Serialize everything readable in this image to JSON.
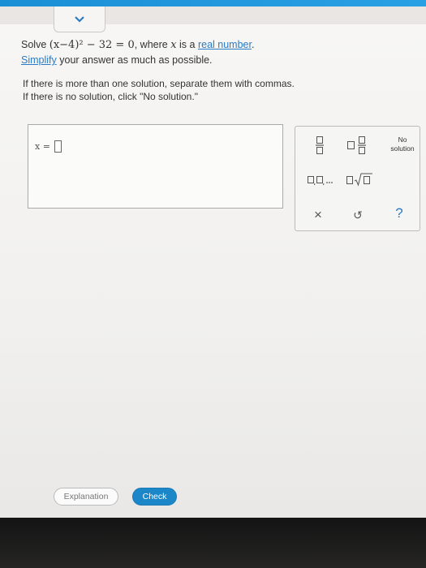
{
  "question": {
    "prefix": "Solve ",
    "equation": "(x−4)² − 32 = 0",
    "mid": ", where ",
    "var": "x",
    "mid2": " is a ",
    "link": "real number",
    "end": ".",
    "simplify_link": "Simplify",
    "simplify_rest": " your answer as much as possible."
  },
  "instructions": {
    "line1": "If there is more than one solution, separate them with commas.",
    "line2": "If there is no solution, click \"No solution.\""
  },
  "answer": {
    "label": "x =",
    "value": ""
  },
  "keypad": {
    "no_solution_line1": "No",
    "no_solution_line2": "solution",
    "clear_label": "×",
    "undo_label": "↺",
    "help_label": "?"
  },
  "buttons": {
    "explanation": "Explanation",
    "check": "Check"
  },
  "colors": {
    "accent": "#1b87c9",
    "link": "#2b7bc4"
  }
}
